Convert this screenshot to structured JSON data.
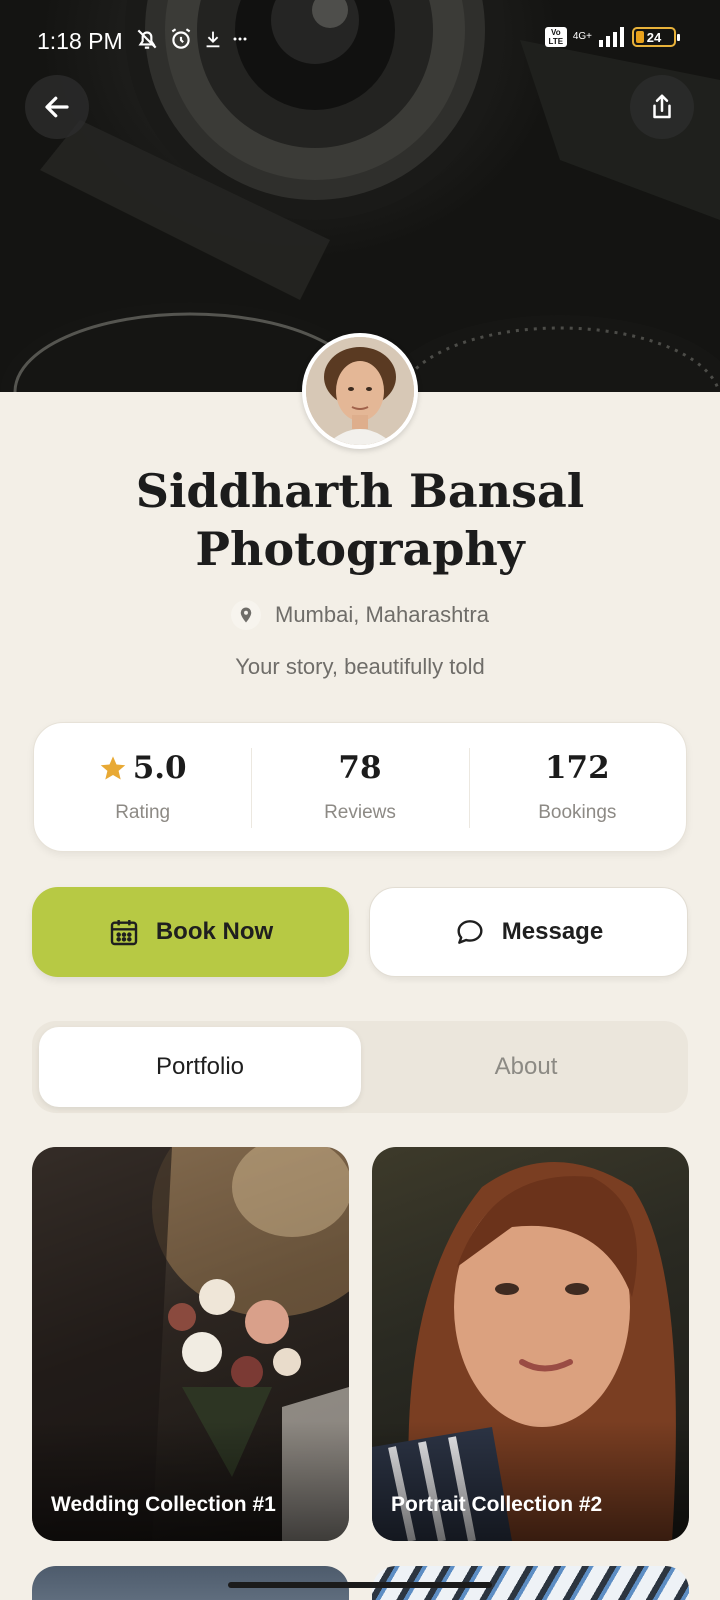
{
  "status_bar": {
    "time": "1:18 PM",
    "network": "4G+",
    "volte": "Vo LTE",
    "battery": "24"
  },
  "hero": {
    "back_icon": "arrow-left-icon",
    "share_icon": "share-icon"
  },
  "profile": {
    "title": "Siddharth Bansal Photography",
    "location": "Mumbai, Maharashtra",
    "tagline": "Your story, beautifully told"
  },
  "stats": [
    {
      "value": "5.0",
      "label": "Rating",
      "icon": "star-icon"
    },
    {
      "value": "78",
      "label": "Reviews"
    },
    {
      "value": "172",
      "label": "Bookings"
    }
  ],
  "actions": {
    "book_label": "Book Now",
    "message_label": "Message"
  },
  "tabs": [
    {
      "label": "Portfolio",
      "active": true
    },
    {
      "label": "About",
      "active": false
    }
  ],
  "portfolio": [
    {
      "label": "Wedding Collection #1"
    },
    {
      "label": "Portrait Collection #2"
    }
  ],
  "colors": {
    "background": "#f3efe7",
    "accent": "#b7c944",
    "star": "#e8a934"
  }
}
